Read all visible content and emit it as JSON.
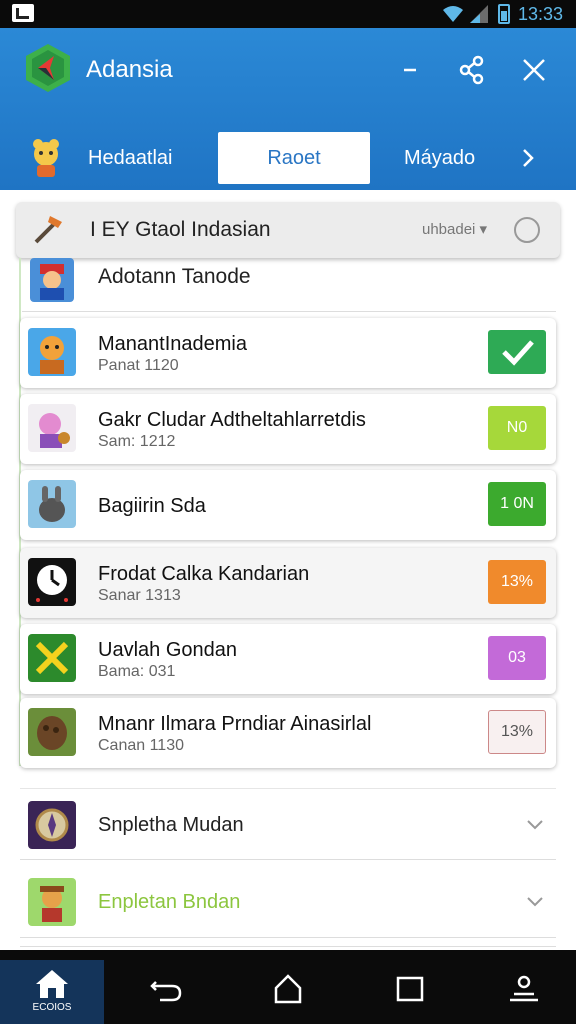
{
  "status": {
    "time": "13:33"
  },
  "app": {
    "title": "Adansia"
  },
  "tabs": [
    {
      "label": "Hedaatlai"
    },
    {
      "label": "Raoet"
    },
    {
      "label": "Máyado"
    }
  ],
  "search": {
    "text": "I EY  Gtaol Indasian",
    "dropdown": "uhbadei ▾"
  },
  "first_row": {
    "title": "Adotann Tanode"
  },
  "cards": [
    {
      "title": "ManantInademia",
      "subtitle": "Panat 1120",
      "badge": "✔",
      "badge_color": "#2eaa55"
    },
    {
      "title": "Gakr Cludar Adtheltahlarretdis",
      "subtitle": "Sam: 1212",
      "badge": "N0",
      "badge_color": "#a6d83a"
    },
    {
      "title": "Bagiirin Sda",
      "subtitle": "",
      "badge": "1 0N",
      "badge_color": "#3caa2e"
    },
    {
      "title": "Frodat Calka Kandarian",
      "subtitle": "Sanar 1313",
      "badge": "13%",
      "badge_color": "#f08a2c"
    },
    {
      "title": "Uavlah Gondan",
      "subtitle": "Bama: 031",
      "badge": "03",
      "badge_color": "#c36ad8"
    },
    {
      "title": "Mnanr Ilmara Prndiar Ainasirlal",
      "subtitle": "Canan 1130",
      "badge": "13%",
      "badge_color": "#f8f0f0"
    }
  ],
  "rows": [
    {
      "title": "Snpletha Mudan",
      "color": "#222222"
    },
    {
      "title": "Enpletan Bndan",
      "color": "#8cc63f"
    }
  ],
  "nav": {
    "home_label": "ECOIOS"
  }
}
